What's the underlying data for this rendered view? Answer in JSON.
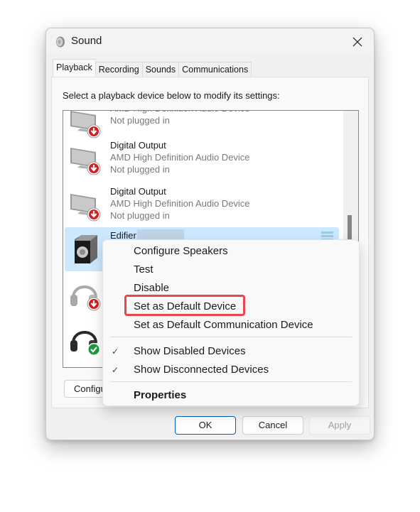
{
  "window": {
    "title": "Sound",
    "app_icon": "speaker-icon",
    "close_icon": "close-icon"
  },
  "tabs": [
    {
      "label": "Playback",
      "active": true
    },
    {
      "label": "Recording",
      "active": false
    },
    {
      "label": "Sounds",
      "active": false
    },
    {
      "label": "Communications",
      "active": false
    }
  ],
  "playback": {
    "instruction": "Select a playback device below to modify its settings:",
    "devices": [
      {
        "name": "",
        "description": "AMD High Definition Audio Device",
        "status": "Not plugged in",
        "icon": "monitor-icon",
        "badge": "unplugged-icon"
      },
      {
        "name": "Digital Output",
        "description": "AMD High Definition Audio Device",
        "status": "Not plugged in",
        "icon": "monitor-icon",
        "badge": "unplugged-icon"
      },
      {
        "name": "Digital Output",
        "description": "AMD High Definition Audio Device",
        "status": "Not plugged in",
        "icon": "monitor-icon",
        "badge": "unplugged-icon"
      },
      {
        "name": "Edifier",
        "description": "",
        "status": "",
        "icon": "speaker-icon",
        "badge": "",
        "selected": true
      },
      {
        "name": "",
        "description": "",
        "status": "",
        "icon": "headphones-icon",
        "badge": "unplugged-icon"
      },
      {
        "name": "",
        "description": "",
        "status": "",
        "icon": "headphones-icon",
        "badge": "default-check-icon"
      }
    ],
    "configure_label": "Configure"
  },
  "context_menu": {
    "items": [
      {
        "label": "Configure Speakers"
      },
      {
        "label": "Test"
      },
      {
        "label": "Disable"
      },
      {
        "label": "Set as Default Device",
        "highlighted": true
      },
      {
        "label": "Set as Default Communication Device"
      },
      {
        "label": "Show Disabled Devices",
        "checked": true
      },
      {
        "label": "Show Disconnected Devices",
        "checked": true
      },
      {
        "label": "Properties",
        "bold": true
      }
    ],
    "check_glyph": "✓"
  },
  "buttons": {
    "ok": "OK",
    "cancel": "Cancel",
    "apply": "Apply"
  },
  "colors": {
    "selection": "#cce8ff",
    "highlight_border": "#e8484d",
    "ok_border": "#005fb8"
  }
}
